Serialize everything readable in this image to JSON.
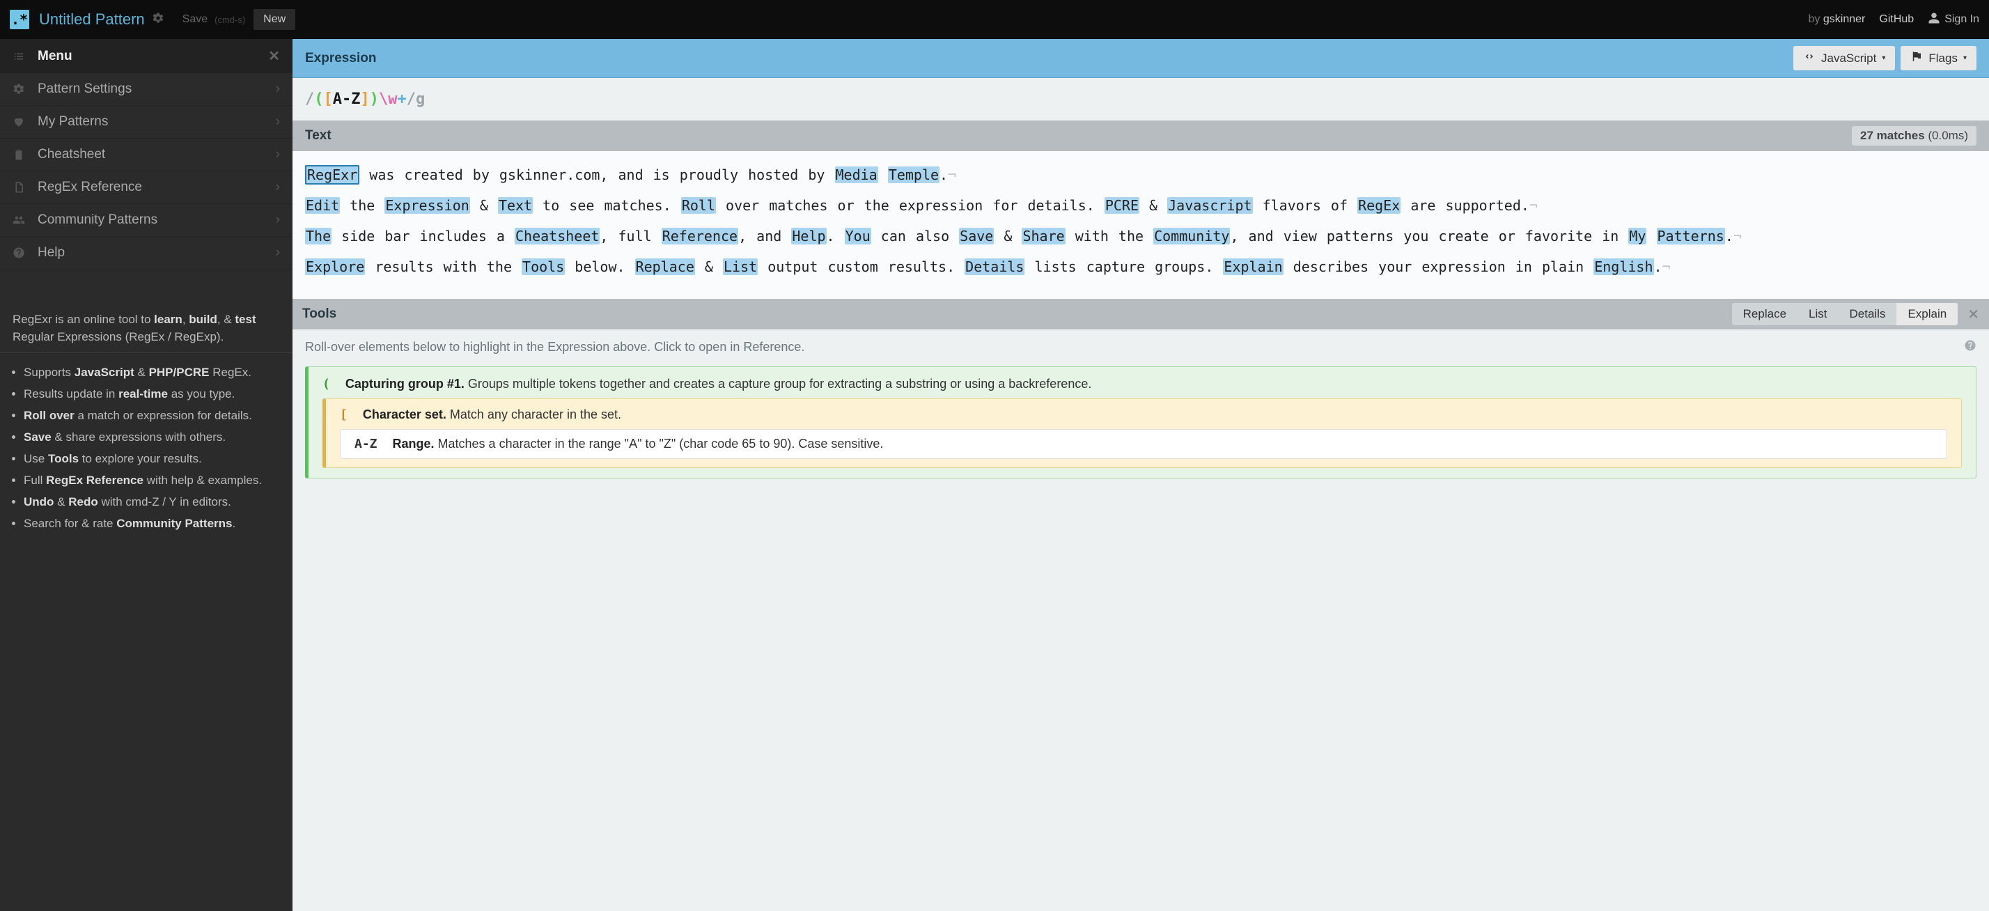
{
  "topbar": {
    "title": "Untitled Pattern",
    "save": "Save",
    "save_hint": "(cmd-s)",
    "new": "New",
    "by_prefix": "by ",
    "author": "gskinner",
    "github": "GitHub",
    "signin": "Sign In"
  },
  "sidebar": {
    "menu_label": "Menu",
    "items": [
      {
        "label": "Pattern Settings"
      },
      {
        "label": "My Patterns"
      },
      {
        "label": "Cheatsheet"
      },
      {
        "label": "RegEx Reference"
      },
      {
        "label": "Community Patterns"
      },
      {
        "label": "Help"
      }
    ],
    "desc_pre": "RegExr is an online tool to ",
    "desc_learn": "learn",
    "desc_build": "build",
    "desc_test": "test",
    "desc_post": " Regular Expressions (RegEx / RegExp).",
    "bullets": [
      {
        "pre": "Supports ",
        "b1": "JavaScript",
        "mid": " & ",
        "b2": "PHP/PCRE",
        "post": " RegEx."
      },
      {
        "pre": "Results update in ",
        "b1": "real-time",
        "post": " as you type."
      },
      {
        "b1": "Roll over",
        "post": " a match or expression for details."
      },
      {
        "b1": "Save",
        "post": " & share expressions with others."
      },
      {
        "pre": "Use ",
        "b1": "Tools",
        "post": " to explore your results."
      },
      {
        "pre": "Full ",
        "b1": "RegEx Reference",
        "post": " with help & examples."
      },
      {
        "b1": "Undo",
        "mid": " & ",
        "b2": "Redo",
        "post": " with cmd-Z / Y in editors."
      },
      {
        "pre": "Search for & rate ",
        "b1": "Community Patterns",
        "post": "."
      }
    ]
  },
  "expression": {
    "label": "Expression",
    "flavor": "JavaScript",
    "flags_label": "Flags",
    "open": "/",
    "lparen": "(",
    "lbracket": "[",
    "range": "A-Z",
    "rbracket": "]",
    "rparen": ")",
    "wclass": "\\w",
    "plus": "+",
    "close": "/",
    "flags": "g"
  },
  "text": {
    "label": "Text",
    "match_count": "27 matches",
    "match_time": " (0.0ms)"
  },
  "tools": {
    "label": "Tools",
    "tabs": {
      "replace": "Replace",
      "list": "List",
      "details": "Details",
      "explain": "Explain"
    },
    "hint": "Roll-over elements below to highlight in the Expression above. Click to open in Reference.",
    "explain": {
      "group_tok": "(",
      "group_title": "Capturing group #1.",
      "group_desc": " Groups multiple tokens together and creates a capture group for extracting a substring or using a backreference.",
      "set_tok": "[",
      "set_title": "Character set.",
      "set_desc": " Match any character in the set.",
      "range_tok": "A-Z",
      "range_title": "Range.",
      "range_desc": " Matches a character in the range \"A\" to \"Z\" (char code 65 to 90). Case sensitive."
    }
  }
}
